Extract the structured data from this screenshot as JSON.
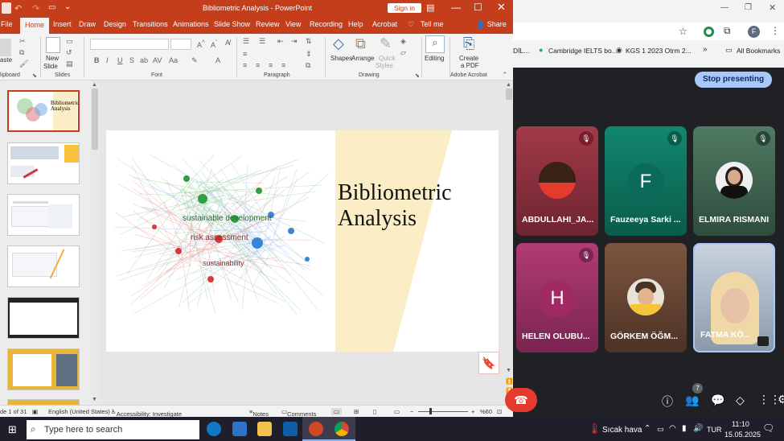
{
  "ppt": {
    "title": "Bibliometric Analysis  -  PowerPoint",
    "sign_in": "Sign in",
    "tabs": [
      "File",
      "Home",
      "Insert",
      "Draw",
      "Design",
      "Transitions",
      "Animations",
      "Slide Show",
      "Review",
      "View",
      "Recording",
      "Help",
      "Acrobat"
    ],
    "tell_me": "Tell me",
    "share": "Share",
    "groups": {
      "clipboard": "lipboard",
      "slides": "Slides",
      "font": "Font",
      "paragraph": "Paragraph",
      "drawing": "Drawing",
      "editing": "",
      "acrobat": "Adobe Acrobat"
    },
    "buttons": {
      "paste": "aste",
      "new_slide": "New",
      "new_slide2": "Slide",
      "shapes": "Shapes",
      "arrange": "Arrange",
      "quick": "Quick",
      "styles": "Styles",
      "editing": "Editing",
      "create": "Create",
      "pdf": "a PDF"
    },
    "slide": {
      "title_line1": "Bibliometric",
      "title_line2": "Analysis",
      "network_labels": [
        "sustainable development",
        "risk assessment",
        "sustainability"
      ]
    },
    "thumb_title": "Bibliometric\nAnalysis",
    "status": {
      "slide": "de 1 of 31",
      "lang": "English (United States)",
      "access": "Accessibility: Investigate",
      "notes": "Notes",
      "comments": "Comments",
      "zoom": "%60"
    }
  },
  "chrome": {
    "tab_items": [
      "DİL...",
      "Cambridge IELTS bo...",
      "KGS 1 2023 Otrm 2...",
      "All Bookmarks"
    ]
  },
  "meet": {
    "stop_presenting": "Stop presenting",
    "participants": [
      {
        "name": "ABDULLAHI_JA...",
        "muted": true,
        "color": "#8c2f3a"
      },
      {
        "name": "Fauzeeya Sarki ...",
        "initial": "F",
        "muted": true,
        "color": "#0d7a68"
      },
      {
        "name": "ELMIRA RISMANI",
        "muted": true,
        "color": "#3d6b55"
      },
      {
        "name": "HELEN OLUBU...",
        "initial": "H",
        "muted": true,
        "color": "#a3316a"
      },
      {
        "name": "GÖRKEM ÖĞM...",
        "muted": false,
        "color": "#6d4a35"
      },
      {
        "name": "FATMA KÖ...",
        "muted": false,
        "color": "#7c8da3"
      }
    ],
    "people_count": "7"
  },
  "taskbar": {
    "search": "Type here to search",
    "weather": "Sıcak hava",
    "lang": "TUR",
    "time": "11:10",
    "date": "15.05.2025"
  }
}
